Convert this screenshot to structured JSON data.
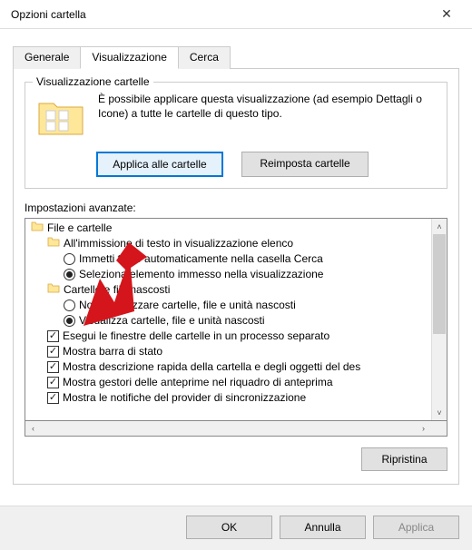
{
  "window": {
    "title": "Opzioni cartella"
  },
  "tabs": {
    "general": "Generale",
    "view": "Visualizzazione",
    "search": "Cerca"
  },
  "folder_views": {
    "group_title": "Visualizzazione cartelle",
    "desc": "È possibile applicare questa visualizzazione (ad esempio Dettagli o Icone) a tutte le cartelle di questo tipo.",
    "apply_btn": "Applica alle cartelle",
    "reset_btn": "Reimposta cartelle"
  },
  "advanced": {
    "label": "Impostazioni avanzate:",
    "tree": [
      {
        "type": "folder",
        "indent": 0,
        "text": "File e cartelle"
      },
      {
        "type": "folder",
        "indent": 1,
        "text": "All'immissione di testo in visualizzazione elenco"
      },
      {
        "type": "radio",
        "indent": 2,
        "checked": false,
        "text": "Immetti testo automaticamente nella casella Cerca"
      },
      {
        "type": "radio",
        "indent": 2,
        "checked": true,
        "text": "Seleziona elemento immesso nella visualizzazione"
      },
      {
        "type": "folder",
        "indent": 1,
        "text": "Cartelle e file nascosti"
      },
      {
        "type": "radio",
        "indent": 2,
        "checked": false,
        "text": "Non visualizzare cartelle, file e unità nascosti"
      },
      {
        "type": "radio",
        "indent": 2,
        "checked": true,
        "text": "Visualizza cartelle, file e unità nascosti"
      },
      {
        "type": "check",
        "indent": 1,
        "checked": true,
        "text": "Esegui le finestre delle cartelle in un processo separato"
      },
      {
        "type": "check",
        "indent": 1,
        "checked": true,
        "text": "Mostra barra di stato"
      },
      {
        "type": "check",
        "indent": 1,
        "checked": true,
        "text": "Mostra descrizione rapida della cartella e degli oggetti del des"
      },
      {
        "type": "check",
        "indent": 1,
        "checked": true,
        "text": "Mostra gestori delle anteprime nel riquadro di anteprima"
      },
      {
        "type": "check",
        "indent": 1,
        "checked": true,
        "text": "Mostra le notifiche del provider di sincronizzazione"
      }
    ],
    "restore_btn": "Ripristina"
  },
  "dialog_buttons": {
    "ok": "OK",
    "cancel": "Annulla",
    "apply": "Applica"
  },
  "icons": {
    "close": "✕",
    "up": "˄",
    "down": "˅",
    "left": "‹",
    "right": "›",
    "check": "✓"
  }
}
